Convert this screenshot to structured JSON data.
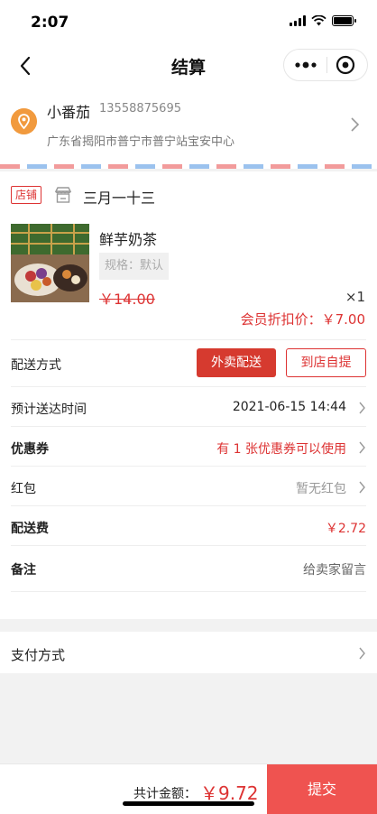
{
  "status_bar": {
    "time": "2:07"
  },
  "nav": {
    "title": "结算"
  },
  "address": {
    "name": "小番茄",
    "phone": "13558875695",
    "detail": "广东省揭阳市普宁市普宁站宝安中心"
  },
  "store": {
    "tag": "店铺",
    "name": "三月一十三"
  },
  "goods": {
    "name": "鲜芋奶茶",
    "spec": "规格：默认",
    "original_price": "￥14.00",
    "quantity": "×1",
    "member_price": "会员折扣价：￥7.00"
  },
  "delivery": {
    "label": "配送方式",
    "option_delivery": "外卖配送",
    "option_pickup": "到店自提"
  },
  "rows": {
    "eta_label": "预计送达时间",
    "eta_value": "2021-06-15 14:44",
    "coupon_label": "优惠券",
    "coupon_value": "有 1 张优惠券可以使用",
    "redpacket_label": "红包",
    "redpacket_value": "暂无红包",
    "fee_label": "配送费",
    "fee_value": "￥2.72",
    "note_label": "备注",
    "note_value": "给卖家留言"
  },
  "payment": {
    "label": "支付方式"
  },
  "footer": {
    "total_label": "共计金额：",
    "total_value": "￥9.72",
    "submit_label": "提交"
  },
  "colors": {
    "accent": "#d63a2f",
    "submit": "#ef5350",
    "pin": "#f19a3e"
  }
}
